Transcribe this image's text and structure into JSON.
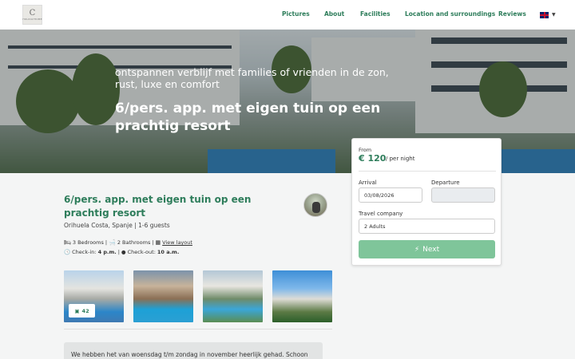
{
  "header": {
    "logo_letter": "C",
    "logo_text": "HOLIDAYHOME",
    "nav": [
      {
        "label": "Pictures"
      },
      {
        "label": "About"
      },
      {
        "label": "Facilities"
      },
      {
        "label": "Location and surroundings"
      },
      {
        "label": "Reviews"
      }
    ],
    "language_icon": "uk-flag-icon"
  },
  "hero": {
    "subtitle": "ontspannen verblijf met families of vrienden in de zon, rust, luxe en comfort",
    "title": "6/pers. app. met eigen tuin op een prachtig resort"
  },
  "booking": {
    "from_label": "From",
    "price": "€ 120",
    "per_night": "/ per night",
    "arrival_label": "Arrival",
    "arrival_value": "03/08/2026",
    "departure_label": "Departure",
    "departure_value": "",
    "travel_label": "Travel company",
    "travel_value": "2 Adults",
    "next_label": "Next",
    "accent": "#2e7d5b",
    "button_color": "#7fc59a"
  },
  "property": {
    "title": "6/pers. app. met eigen tuin op een prachtig resort",
    "location": "Orihuela Costa, Spanje | 1-6 guests",
    "bedrooms": "3 Bedrooms",
    "bathrooms": "2 Bathrooms",
    "layout_link": "View layout",
    "checkin_label": "Check-in:",
    "checkin_value": "4 p.m.",
    "checkout_label": "Check-out:",
    "checkout_value": "10 a.m.",
    "photo_count": "42"
  },
  "review": {
    "text": "We hebben het van woensdag t/m zondag in november heerlijk gehad. Schoon"
  }
}
